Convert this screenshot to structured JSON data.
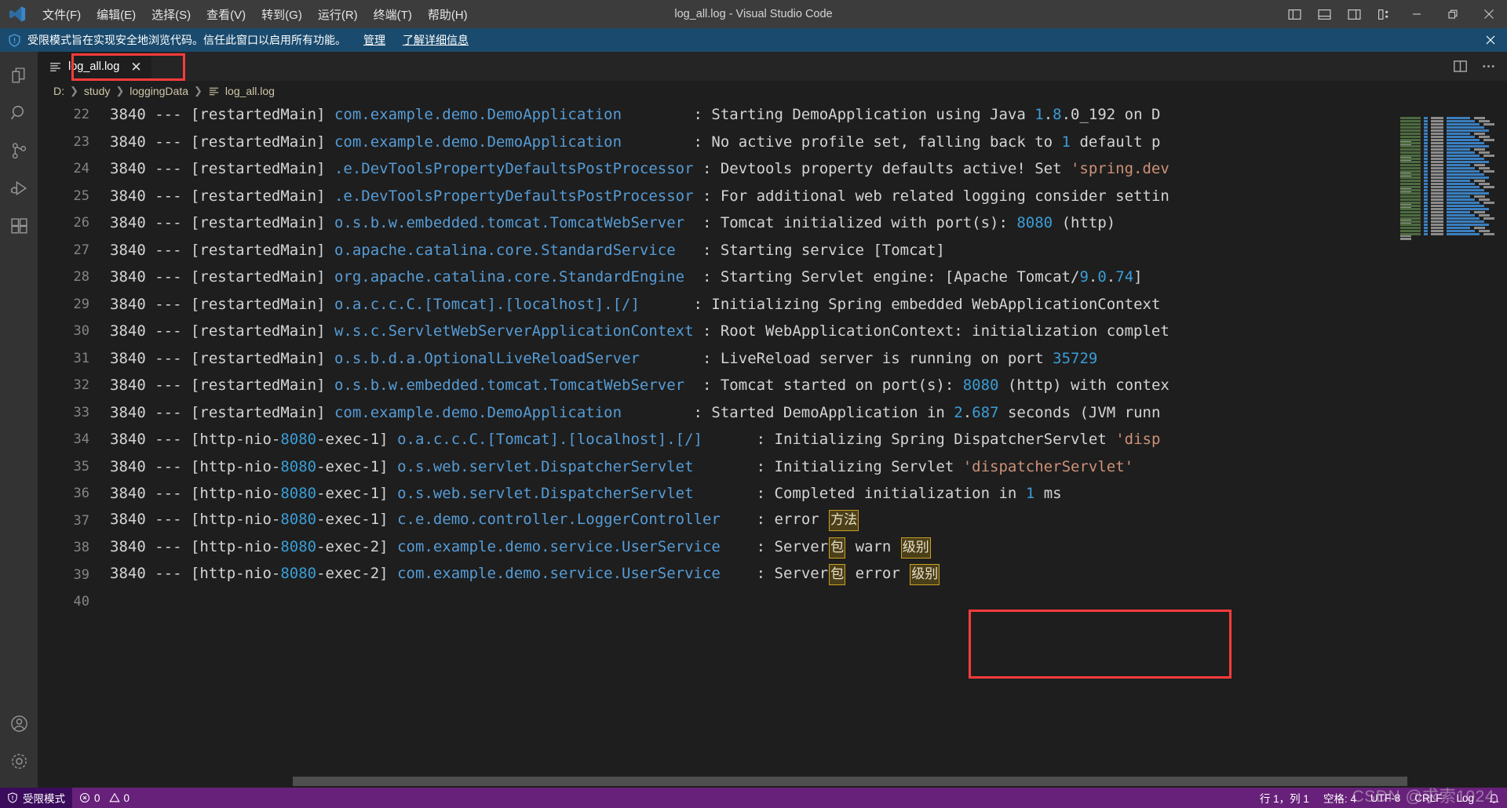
{
  "window": {
    "title": "log_all.log - Visual Studio Code",
    "logo_icon": "vscode-logo"
  },
  "menubar": {
    "items": [
      {
        "label": "文件(F)",
        "name": "menu-file"
      },
      {
        "label": "编辑(E)",
        "name": "menu-edit"
      },
      {
        "label": "选择(S)",
        "name": "menu-selection"
      },
      {
        "label": "查看(V)",
        "name": "menu-view"
      },
      {
        "label": "转到(G)",
        "name": "menu-go"
      },
      {
        "label": "运行(R)",
        "name": "menu-run"
      },
      {
        "label": "终端(T)",
        "name": "menu-terminal"
      },
      {
        "label": "帮助(H)",
        "name": "menu-help"
      }
    ]
  },
  "titlebar_controls": {
    "layout_icons": [
      "toggle-primary-sidebar-icon",
      "toggle-panel-icon",
      "toggle-secondary-sidebar-icon",
      "customize-layout-icon"
    ],
    "minimize": "minimize-icon",
    "restore": "restore-icon",
    "close": "close-icon"
  },
  "banner": {
    "icon": "shield-icon",
    "text": "受限模式旨在实现安全地浏览代码。信任此窗口以启用所有功能。",
    "manage_link": "管理",
    "learn_more_link": "了解详细信息",
    "close_icon": "close-icon",
    "background": "#1a4b6e"
  },
  "activitybar": {
    "items": [
      {
        "label": "资源管理器",
        "name": "sidebar-item-explorer",
        "icon": "files-icon"
      },
      {
        "label": "搜索",
        "name": "sidebar-item-search",
        "icon": "search-icon"
      },
      {
        "label": "源代码管理",
        "name": "sidebar-item-source-control",
        "icon": "source-control-icon"
      },
      {
        "label": "运行和调试",
        "name": "sidebar-item-run-debug",
        "icon": "run-debug-icon"
      },
      {
        "label": "扩展",
        "name": "sidebar-item-extensions",
        "icon": "extensions-icon"
      }
    ],
    "bottom": [
      {
        "label": "账户",
        "name": "accounts-button",
        "icon": "account-icon"
      },
      {
        "label": "管理",
        "name": "manage-button",
        "icon": "gear-icon"
      }
    ]
  },
  "tabs": [
    {
      "label": "log_all.log",
      "icon": "log-file-icon",
      "close_icon": "close-icon",
      "active": true
    }
  ],
  "editor_actions": {
    "split_editor": "split-editor-icon",
    "more_actions": "more-actions-icon"
  },
  "breadcrumb": {
    "items": [
      "D:",
      "study",
      "loggingData",
      "log_all.log"
    ],
    "separator": "›",
    "file_icon": "log-file-icon"
  },
  "annotations": {
    "tab_box_color": "#fb3b3b",
    "log_box_color": "#fb3b3b",
    "highlight_border": "#c8a020",
    "highlight_fill": "#4b3f1a"
  },
  "editor": {
    "first_visible_line": 22,
    "lines": [
      {
        "no": 22,
        "segments": [
          {
            "t": "3840 --- [restartedMain] ",
            "c": "plain"
          },
          {
            "t": "com.example.demo.DemoApplication",
            "c": "blue"
          },
          {
            "t": "        : Starting DemoApplication using Java ",
            "c": "plain"
          },
          {
            "t": "1",
            "c": "num"
          },
          {
            "t": ".",
            "c": "plain"
          },
          {
            "t": "8",
            "c": "num"
          },
          {
            "t": ".0_192 on D",
            "c": "plain"
          }
        ]
      },
      {
        "no": 23,
        "segments": [
          {
            "t": "3840 --- [restartedMain] ",
            "c": "plain"
          },
          {
            "t": "com.example.demo.DemoApplication",
            "c": "blue"
          },
          {
            "t": "        : No active profile set, falling back to ",
            "c": "plain"
          },
          {
            "t": "1",
            "c": "num"
          },
          {
            "t": " default p",
            "c": "plain"
          }
        ]
      },
      {
        "no": 24,
        "segments": [
          {
            "t": "3840 --- [restartedMain] ",
            "c": "plain"
          },
          {
            "t": ".e.DevToolsPropertyDefaultsPostProcessor",
            "c": "blue"
          },
          {
            "t": " : Devtools property defaults active! Set ",
            "c": "plain"
          },
          {
            "t": "'spring.dev",
            "c": "str"
          }
        ]
      },
      {
        "no": 25,
        "segments": [
          {
            "t": "3840 --- [restartedMain] ",
            "c": "plain"
          },
          {
            "t": ".e.DevToolsPropertyDefaultsPostProcessor",
            "c": "blue"
          },
          {
            "t": " : For additional web related logging consider settin",
            "c": "plain"
          }
        ]
      },
      {
        "no": 26,
        "segments": [
          {
            "t": "3840 --- [restartedMain] ",
            "c": "plain"
          },
          {
            "t": "o.s.b.w.embedded.tomcat.TomcatWebServer",
            "c": "blue"
          },
          {
            "t": "  : Tomcat initialized with port(s): ",
            "c": "plain"
          },
          {
            "t": "8080",
            "c": "num"
          },
          {
            "t": " (http)",
            "c": "plain"
          }
        ]
      },
      {
        "no": 27,
        "segments": [
          {
            "t": "3840 --- [restartedMain] ",
            "c": "plain"
          },
          {
            "t": "o.apache.catalina.core.StandardService",
            "c": "blue"
          },
          {
            "t": "   : Starting service [Tomcat]",
            "c": "plain"
          }
        ]
      },
      {
        "no": 28,
        "segments": [
          {
            "t": "3840 --- [restartedMain] ",
            "c": "plain"
          },
          {
            "t": "org.apache.catalina.core.StandardEngine",
            "c": "blue"
          },
          {
            "t": "  : Starting Servlet engine: [Apache Tomcat/",
            "c": "plain"
          },
          {
            "t": "9",
            "c": "num"
          },
          {
            "t": ".",
            "c": "plain"
          },
          {
            "t": "0",
            "c": "num"
          },
          {
            "t": ".",
            "c": "plain"
          },
          {
            "t": "74",
            "c": "num"
          },
          {
            "t": "]",
            "c": "plain"
          }
        ]
      },
      {
        "no": 29,
        "segments": [
          {
            "t": "3840 --- [restartedMain] ",
            "c": "plain"
          },
          {
            "t": "o.a.c.c.C.[Tomcat].[localhost].[/]",
            "c": "blue"
          },
          {
            "t": "      : Initializing Spring embedded WebApplicationContext",
            "c": "plain"
          }
        ]
      },
      {
        "no": 30,
        "segments": [
          {
            "t": "3840 --- [restartedMain] ",
            "c": "plain"
          },
          {
            "t": "w.s.c.ServletWebServerApplicationContext",
            "c": "blue"
          },
          {
            "t": " : Root WebApplicationContext: initialization complet",
            "c": "plain"
          }
        ]
      },
      {
        "no": 31,
        "segments": [
          {
            "t": "3840 --- [restartedMain] ",
            "c": "plain"
          },
          {
            "t": "o.s.b.d.a.OptionalLiveReloadServer",
            "c": "blue"
          },
          {
            "t": "       : LiveReload server is running on port ",
            "c": "plain"
          },
          {
            "t": "35729",
            "c": "num"
          }
        ]
      },
      {
        "no": 32,
        "segments": [
          {
            "t": "3840 --- [restartedMain] ",
            "c": "plain"
          },
          {
            "t": "o.s.b.w.embedded.tomcat.TomcatWebServer",
            "c": "blue"
          },
          {
            "t": "  : Tomcat started on port(s): ",
            "c": "plain"
          },
          {
            "t": "8080",
            "c": "num"
          },
          {
            "t": " (http) with contex",
            "c": "plain"
          }
        ]
      },
      {
        "no": 33,
        "segments": [
          {
            "t": "3840 --- [restartedMain] ",
            "c": "plain"
          },
          {
            "t": "com.example.demo.DemoApplication",
            "c": "blue"
          },
          {
            "t": "        : Started DemoApplication in ",
            "c": "plain"
          },
          {
            "t": "2",
            "c": "num"
          },
          {
            "t": ".",
            "c": "plain"
          },
          {
            "t": "687",
            "c": "num"
          },
          {
            "t": " seconds (JVM runn",
            "c": "plain"
          }
        ]
      },
      {
        "no": 34,
        "segments": [
          {
            "t": "3840 --- [http-nio-",
            "c": "plain"
          },
          {
            "t": "8080",
            "c": "num"
          },
          {
            "t": "-exec-1] ",
            "c": "plain"
          },
          {
            "t": "o.a.c.c.C.[Tomcat].[localhost].[/]",
            "c": "blue"
          },
          {
            "t": "      : Initializing Spring DispatcherServlet ",
            "c": "plain"
          },
          {
            "t": "'disp",
            "c": "str"
          }
        ]
      },
      {
        "no": 35,
        "segments": [
          {
            "t": "3840 --- [http-nio-",
            "c": "plain"
          },
          {
            "t": "8080",
            "c": "num"
          },
          {
            "t": "-exec-1] ",
            "c": "plain"
          },
          {
            "t": "o.s.web.servlet.DispatcherServlet",
            "c": "blue"
          },
          {
            "t": "       : Initializing Servlet ",
            "c": "plain"
          },
          {
            "t": "'dispatcherServlet'",
            "c": "str"
          }
        ]
      },
      {
        "no": 36,
        "segments": [
          {
            "t": "3840 --- [http-nio-",
            "c": "plain"
          },
          {
            "t": "8080",
            "c": "num"
          },
          {
            "t": "-exec-1] ",
            "c": "plain"
          },
          {
            "t": "o.s.web.servlet.DispatcherServlet",
            "c": "blue"
          },
          {
            "t": "       : Completed initialization in ",
            "c": "plain"
          },
          {
            "t": "1",
            "c": "num"
          },
          {
            "t": " ms",
            "c": "plain"
          }
        ]
      },
      {
        "no": 37,
        "segments": [
          {
            "t": "3840 --- [http-nio-",
            "c": "plain"
          },
          {
            "t": "8080",
            "c": "num"
          },
          {
            "t": "-exec-1] ",
            "c": "plain"
          },
          {
            "t": "c.e.demo.controller.LoggerController",
            "c": "blue"
          },
          {
            "t": "    : error ",
            "c": "plain"
          },
          {
            "t": "方法",
            "c": "hl"
          }
        ]
      },
      {
        "no": 38,
        "segments": [
          {
            "t": "3840 --- [http-nio-",
            "c": "plain"
          },
          {
            "t": "8080",
            "c": "num"
          },
          {
            "t": "-exec-2] ",
            "c": "plain"
          },
          {
            "t": "com.example.demo.service.UserService",
            "c": "blue"
          },
          {
            "t": "    : Server",
            "c": "plain"
          },
          {
            "t": "包",
            "c": "hl"
          },
          {
            "t": " warn ",
            "c": "plain"
          },
          {
            "t": "级别",
            "c": "hl"
          }
        ]
      },
      {
        "no": 39,
        "segments": [
          {
            "t": "3840 --- [http-nio-",
            "c": "plain"
          },
          {
            "t": "8080",
            "c": "num"
          },
          {
            "t": "-exec-2] ",
            "c": "plain"
          },
          {
            "t": "com.example.demo.service.UserService",
            "c": "blue"
          },
          {
            "t": "    : Server",
            "c": "plain"
          },
          {
            "t": "包",
            "c": "hl"
          },
          {
            "t": " error ",
            "c": "plain"
          },
          {
            "t": "级别",
            "c": "hl"
          }
        ]
      },
      {
        "no": 40,
        "segments": []
      }
    ]
  },
  "statusbar": {
    "trusted_mode": "受限模式",
    "trusted_icon": "shield-icon",
    "errors_icon": "error-icon",
    "errors": "0",
    "warnings_icon": "warning-icon",
    "warnings": "0",
    "cursor_position": "行 1，列 1",
    "indentation": "空格: 4",
    "encoding": "UTF-8",
    "eol": "CRLF",
    "language": "Log",
    "bell_icon": "bell-icon",
    "background": "#68217a"
  },
  "watermark": "CSDN @求索1024"
}
